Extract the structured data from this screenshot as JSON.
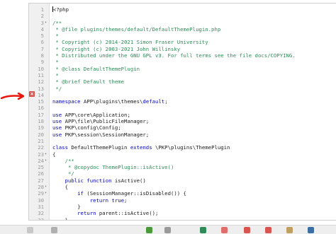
{
  "editor": {
    "lines": [
      {
        "n": "1",
        "fold": "",
        "parts": [
          {
            "t": "<?php",
            "c": ""
          }
        ]
      },
      {
        "n": "2",
        "fold": "",
        "parts": []
      },
      {
        "n": "3",
        "fold": "▾",
        "parts": [
          {
            "t": "/**",
            "c": "cm"
          }
        ]
      },
      {
        "n": "4",
        "fold": "",
        "parts": [
          {
            "t": " * @file plugins/themes/default/DefaultThemePlugin.php",
            "c": "cm"
          }
        ]
      },
      {
        "n": "5",
        "fold": "",
        "parts": [
          {
            "t": " *",
            "c": "cm"
          }
        ]
      },
      {
        "n": "6",
        "fold": "",
        "parts": [
          {
            "t": " * Copyright (c) 2014-2021 Simon Fraser University",
            "c": "cm"
          }
        ]
      },
      {
        "n": "7",
        "fold": "",
        "parts": [
          {
            "t": " * Copyright (c) 2003-2021 John Willinsky",
            "c": "cm"
          }
        ]
      },
      {
        "n": "8",
        "fold": "",
        "parts": [
          {
            "t": " * Distributed under the GNU GPL v3. For full terms see the file docs/COPYING.",
            "c": "cm"
          }
        ]
      },
      {
        "n": "9",
        "fold": "",
        "parts": [
          {
            "t": " *",
            "c": "cm"
          }
        ]
      },
      {
        "n": "10",
        "fold": "",
        "parts": [
          {
            "t": " * @class DefaultThemePlugin",
            "c": "cm"
          }
        ]
      },
      {
        "n": "11",
        "fold": "",
        "parts": [
          {
            "t": " *",
            "c": "cm"
          }
        ]
      },
      {
        "n": "12",
        "fold": "",
        "parts": [
          {
            "t": " * @brief Default theme",
            "c": "cm"
          }
        ]
      },
      {
        "n": "13",
        "fold": "",
        "parts": [
          {
            "t": " */",
            "c": "cm"
          }
        ]
      },
      {
        "n": "14",
        "fold": "",
        "parts": []
      },
      {
        "n": "15",
        "fold": "",
        "parts": [
          {
            "t": "namespace",
            "c": "kw"
          },
          {
            "t": " APP\\plugins\\themes\\",
            "c": ""
          },
          {
            "t": "default",
            "c": "kw"
          },
          {
            "t": ";",
            "c": ""
          }
        ]
      },
      {
        "n": "16",
        "fold": "",
        "parts": []
      },
      {
        "n": "17",
        "fold": "",
        "parts": [
          {
            "t": "use",
            "c": "kw"
          },
          {
            "t": " APP\\core\\Application;",
            "c": ""
          }
        ]
      },
      {
        "n": "18",
        "fold": "",
        "parts": [
          {
            "t": "use",
            "c": "kw"
          },
          {
            "t": " APP\\file\\PublicFileManager;",
            "c": ""
          }
        ]
      },
      {
        "n": "19",
        "fold": "",
        "parts": [
          {
            "t": "use",
            "c": "kw"
          },
          {
            "t": " PKP\\config\\Config;",
            "c": ""
          }
        ]
      },
      {
        "n": "20",
        "fold": "",
        "parts": [
          {
            "t": "use",
            "c": "kw"
          },
          {
            "t": " PKP\\session\\SessionManager;",
            "c": ""
          }
        ]
      },
      {
        "n": "21",
        "fold": "",
        "parts": []
      },
      {
        "n": "22",
        "fold": "",
        "parts": [
          {
            "t": "class",
            "c": "kw"
          },
          {
            "t": " DefaultThemePlugin ",
            "c": ""
          },
          {
            "t": "extends",
            "c": "kw"
          },
          {
            "t": " \\PKP\\plugins\\ThemePlugin",
            "c": ""
          }
        ]
      },
      {
        "n": "23",
        "fold": "▾",
        "parts": [
          {
            "t": "{",
            "c": ""
          }
        ]
      },
      {
        "n": "24",
        "fold": "▾",
        "parts": [
          {
            "t": "    /**",
            "c": "cm"
          }
        ]
      },
      {
        "n": "25",
        "fold": "",
        "parts": [
          {
            "t": "     * @copydoc ThemePlugin::isActive()",
            "c": "cm"
          }
        ]
      },
      {
        "n": "26",
        "fold": "",
        "parts": [
          {
            "t": "     */",
            "c": "cm"
          }
        ]
      },
      {
        "n": "27",
        "fold": "",
        "parts": [
          {
            "t": "    ",
            "c": ""
          },
          {
            "t": "public function",
            "c": "kw"
          },
          {
            "t": " isActive()",
            "c": ""
          }
        ]
      },
      {
        "n": "28",
        "fold": "▾",
        "parts": [
          {
            "t": "    {",
            "c": ""
          }
        ]
      },
      {
        "n": "29",
        "fold": "▾",
        "parts": [
          {
            "t": "        ",
            "c": ""
          },
          {
            "t": "if",
            "c": "kw"
          },
          {
            "t": " (SessionManager::isDisabled()) {",
            "c": ""
          }
        ]
      },
      {
        "n": "30",
        "fold": "",
        "parts": [
          {
            "t": "            ",
            "c": ""
          },
          {
            "t": "return true",
            "c": "kw"
          },
          {
            "t": ";",
            "c": ""
          }
        ]
      },
      {
        "n": "31",
        "fold": "",
        "parts": [
          {
            "t": "        }",
            "c": ""
          }
        ]
      },
      {
        "n": "32",
        "fold": "",
        "parts": [
          {
            "t": "        ",
            "c": ""
          },
          {
            "t": "return",
            "c": "kw"
          },
          {
            "t": " parent::isActive();",
            "c": ""
          }
        ]
      },
      {
        "n": "33",
        "fold": "",
        "parts": [
          {
            "t": "    }",
            "c": ""
          }
        ]
      }
    ]
  },
  "colors": {
    "keyword": "#0000c8",
    "comment": "#2e8b57",
    "error_marker": "#d9534f",
    "annotation_arrow": "#e8160c"
  },
  "icons": {
    "error_marker": "close-icon",
    "annotation": "red-arrow-icon"
  }
}
